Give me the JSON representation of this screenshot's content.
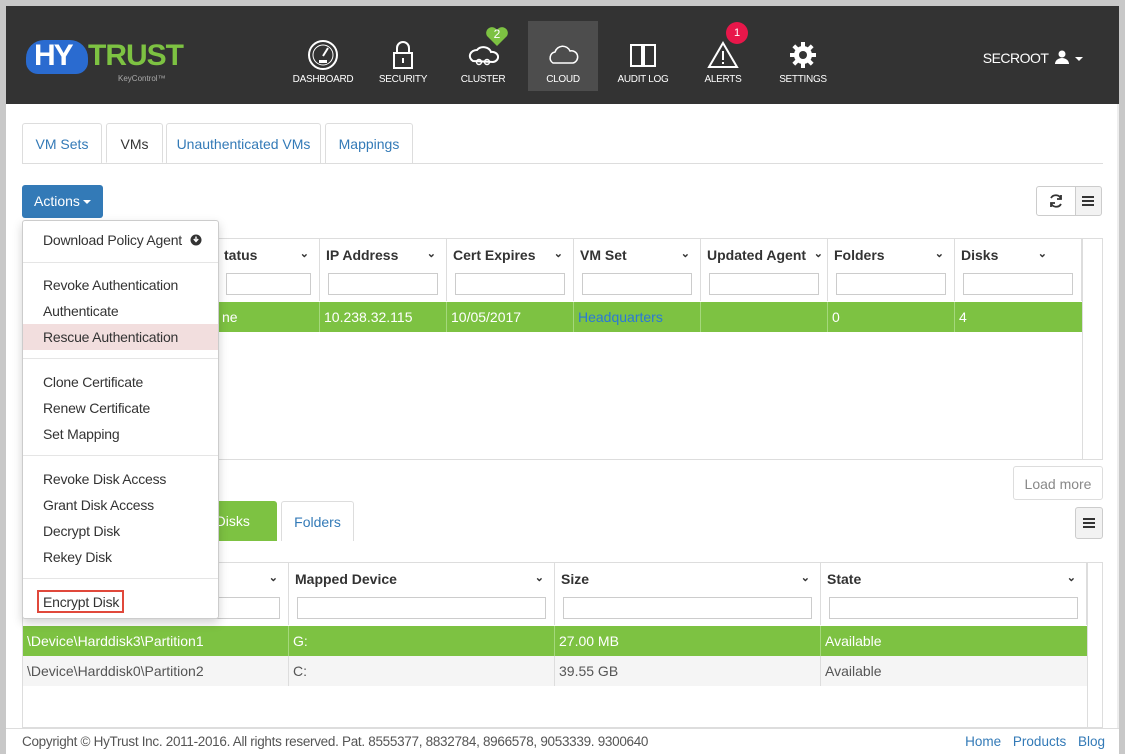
{
  "header": {
    "brand_hy": "HY",
    "brand_trust": "TRUST",
    "brand_sub": "KeyControl™",
    "nav": [
      {
        "label": "DASHBOARD"
      },
      {
        "label": "SECURITY"
      },
      {
        "label": "CLUSTER",
        "badge": "2"
      },
      {
        "label": "CLOUD"
      },
      {
        "label": "AUDIT LOG"
      },
      {
        "label": "ALERTS",
        "badge": "1"
      },
      {
        "label": "SETTINGS"
      }
    ],
    "user": "SECROOT"
  },
  "tabs": [
    "VM Sets",
    "VMs",
    "Unauthenticated VMs",
    "Mappings"
  ],
  "actions_label": "Actions",
  "menu": {
    "download": "Download Policy Agent",
    "revoke_auth": "Revoke Authentication",
    "authenticate": "Authenticate",
    "rescue_auth": "Rescue Authentication",
    "clone_cert": "Clone Certificate",
    "renew_cert": "Renew Certificate",
    "set_mapping": "Set Mapping",
    "revoke_disk": "Revoke Disk Access",
    "grant_disk": "Grant Disk Access",
    "decrypt_disk": "Decrypt Disk",
    "rekey_disk": "Rekey Disk",
    "encrypt_disk": "Encrypt Disk"
  },
  "vm_table": {
    "headers": [
      "tatus",
      "IP Address",
      "Cert Expires",
      "VM Set",
      "Updated Agent",
      "Folders",
      "Disks"
    ],
    "row": [
      "ne",
      "10.238.32.115",
      "10/05/2017",
      "Headquarters",
      "",
      "0",
      "4"
    ]
  },
  "load_more": "Load more",
  "subtabs": {
    "disks": "e Disks",
    "folders": "Folders"
  },
  "disk_table": {
    "headers": [
      "Mapped Device",
      "Size",
      "State"
    ],
    "rows": [
      [
        "\\Device\\Harddisk3\\Partition1",
        "G:",
        "27.00 MB",
        "Available"
      ],
      [
        "\\Device\\Harddisk0\\Partition2",
        "C:",
        "39.55 GB",
        "Available"
      ]
    ]
  },
  "footer": {
    "copyright": "Copyright © HyTrust Inc. 2011-2016. All rights reserved. Pat. 8555377, 8832784, 8966578, 9053339. 9300640",
    "links": [
      "Home",
      "Products",
      "Blog"
    ]
  },
  "colors": {
    "header_bg": "#333333",
    "primary": "#337ab7",
    "green": "#7dc242",
    "alert_badge": "#e8174a",
    "highlight": "#f2dede"
  }
}
